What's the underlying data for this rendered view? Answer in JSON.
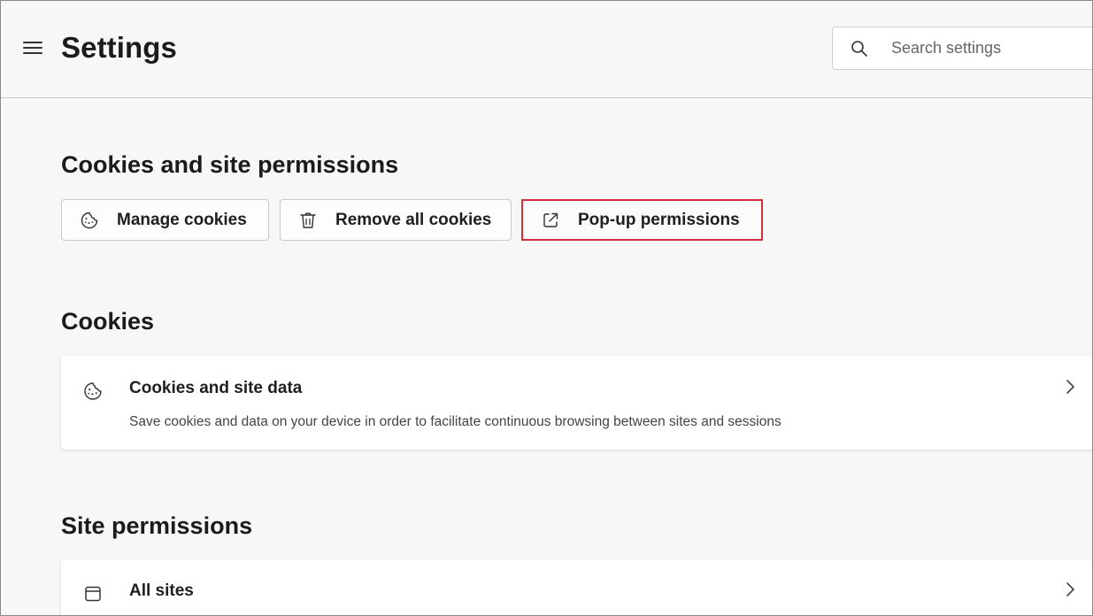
{
  "header": {
    "menu_icon": "hamburger-menu-icon",
    "title": "Settings",
    "search": {
      "placeholder": "Search settings",
      "value": "",
      "icon": "search-icon"
    }
  },
  "cookies_site_permissions": {
    "title": "Cookies and site permissions",
    "buttons": [
      {
        "label": "Manage cookies",
        "icon": "cookie-icon",
        "highlighted": false
      },
      {
        "label": "Remove all cookies",
        "icon": "trash-icon",
        "highlighted": false
      },
      {
        "label": "Pop-up permissions",
        "icon": "open-external-icon",
        "highlighted": true
      }
    ],
    "highlight_color": "#d62d3a"
  },
  "cookies": {
    "title": "Cookies",
    "item": {
      "title": "Cookies and site data",
      "description": "Save cookies and data on your device in order to facilitate continuous browsing between sites and sessions",
      "icon": "cookie-icon"
    }
  },
  "site_permissions": {
    "title": "Site permissions",
    "item": {
      "title": "All sites",
      "icon": "browser-window-icon"
    }
  }
}
